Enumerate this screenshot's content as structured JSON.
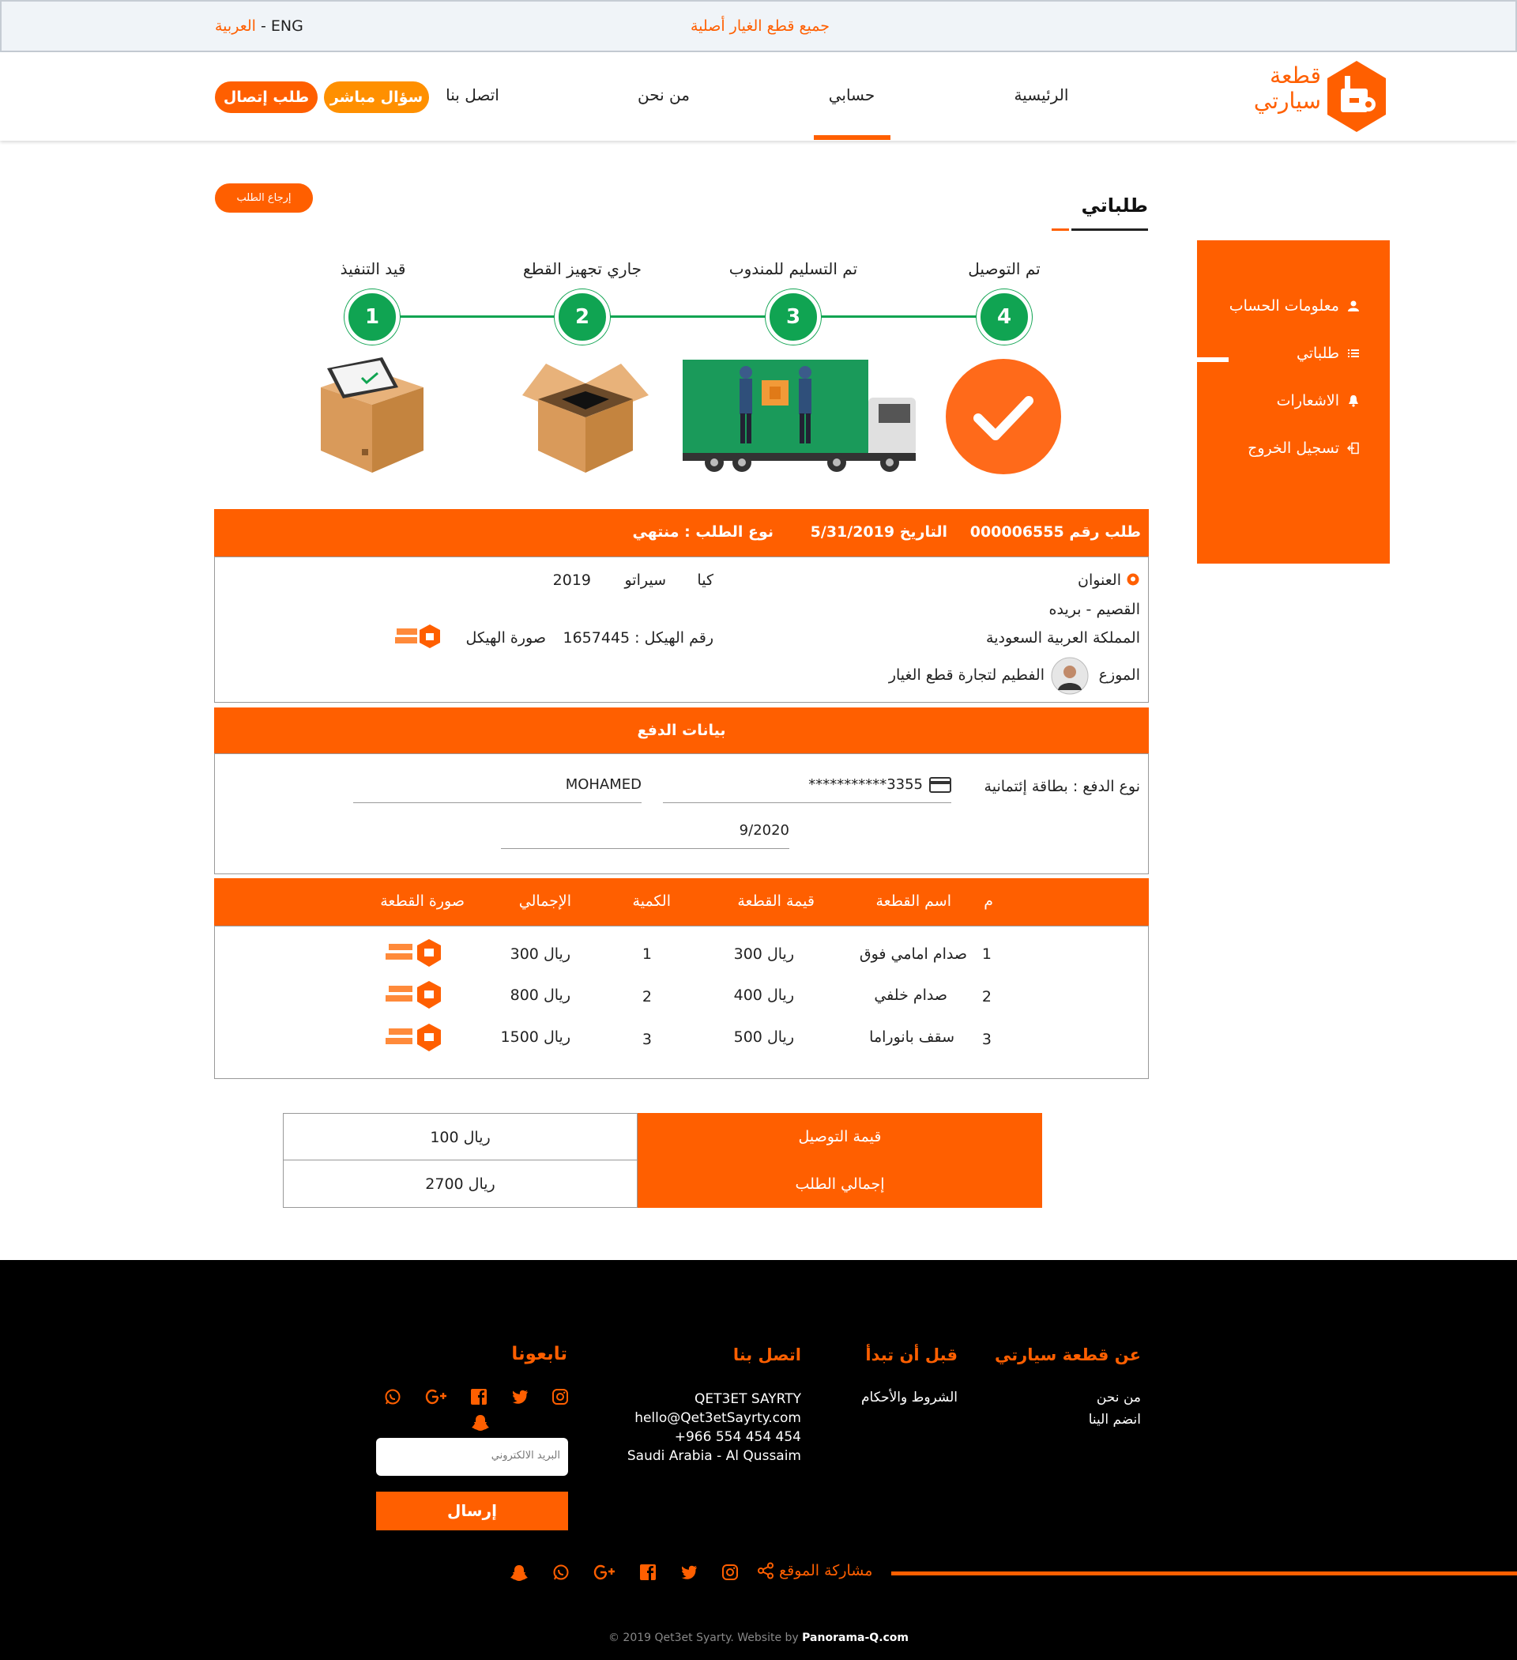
{
  "topbar": {
    "lang_ar": "العربية",
    "lang_sep": " - ",
    "lang_en": "ENG",
    "tagline": "جميع قطع الغيار أصلية"
  },
  "nav": {
    "items": [
      "الرئيسية",
      "حسابي",
      "من نحن",
      "اتصل بنا"
    ],
    "active": "حسابي",
    "direct_question": "سؤال مباشر",
    "call_request": "طلب إتصال"
  },
  "logo": {
    "line1": "قطعة",
    "line2": "سيارتي"
  },
  "sidebar": {
    "items": [
      {
        "label": "معلومات الحساب",
        "icon": "user-icon"
      },
      {
        "label": "طلباتي",
        "icon": "list-icon"
      },
      {
        "label": "الاشعارات",
        "icon": "bell-icon"
      },
      {
        "label": "تسجيل الخروج",
        "icon": "logout-icon"
      }
    ]
  },
  "page": {
    "title": "طلباتي",
    "return_button": "إرجاع الطلب"
  },
  "steps": [
    {
      "number": "4",
      "label": "تم التوصيل"
    },
    {
      "number": "3",
      "label": "تم التسليم للمندوب"
    },
    {
      "number": "2",
      "label": "جاري تجهيز القطع"
    },
    {
      "number": "1",
      "label": "قيد التنفيذ"
    }
  ],
  "order": {
    "number_label": "طلب رقم 000006555",
    "date_label": "التاريخ 5/31/2019",
    "type_label": "نوع الطلب : منتهي",
    "address_title": "العنوان",
    "address_line1": "القصيم - بريده",
    "address_line2": "المملكة العربية السعودية",
    "distributor_label": "الموزع",
    "distributor_name": "الفطيم لتجارة قطع الغيار",
    "car_make": "كيا",
    "car_model": "سيراتو",
    "car_year": "2019",
    "chassis_label": "رقم الهيكل : 1657445",
    "chassis_image_label": "صورة الهيكل"
  },
  "payment": {
    "title": "بيانات الدفع",
    "type_label": "نوع الدفع : بطاقة إئتمانية",
    "card_number": "***********3355",
    "card_holder": "MOHAMED",
    "expiry": "9/2020"
  },
  "parts": {
    "headers": [
      "م",
      "اسم القطعة",
      "قيمة القطعة",
      "الكمية",
      "الإجمالي",
      "صورة القطعة"
    ],
    "rows": [
      {
        "idx": "1",
        "name": "صدام امامي فوق",
        "price": "300 ريال",
        "qty": "1",
        "total": "300 ريال"
      },
      {
        "idx": "2",
        "name": "صدام خلفي",
        "price": "400 ريال",
        "qty": "2",
        "total": "800 ريال"
      },
      {
        "idx": "3",
        "name": "سقف بانوراما",
        "price": "500 ريال",
        "qty": "3",
        "total": "1500 ريال"
      }
    ]
  },
  "summary": {
    "delivery_label": "قيمة التوصيل",
    "delivery_value": "100 ريال",
    "total_label": "إجمالي الطلب",
    "total_value": "2700 ريال"
  },
  "footer": {
    "about_title": "عن قطعة سيارتي",
    "about_links": [
      "من نحن",
      "انضم الينا"
    ],
    "before_title": "قبل أن تبدأ",
    "before_links": [
      "الشروط والأحكام"
    ],
    "contact_title": "اتصل بنا",
    "contact_lines": [
      "QET3ET SAYRTY",
      "hello@Qet3etSayrty.com",
      "+966 554 454 454",
      "Saudi Arabia - Al Qussaim"
    ],
    "follow_title": "تابعونا",
    "email_placeholder": "البريد الالكتروني",
    "send_button": "إرسال",
    "share_label": "مشاركة الموقع",
    "copyright": "© 2019 Qet3et Syarty.  Website by ",
    "credit": "Panorama-Q.com"
  },
  "colors": {
    "accent": "#ff5f00",
    "progress": "#10a452",
    "footer_bg": "#000000"
  }
}
